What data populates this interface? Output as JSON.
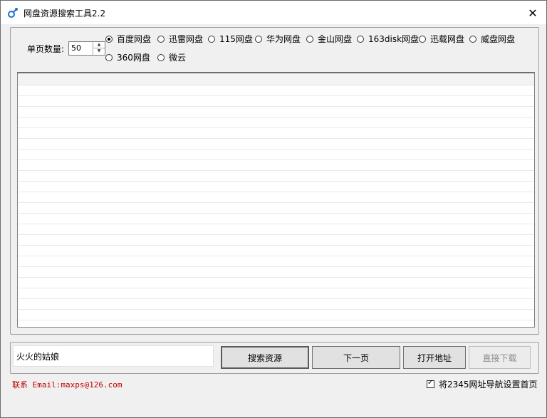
{
  "window": {
    "title": "网盘资源搜索工具2.2",
    "close_glyph": "✕"
  },
  "settings": {
    "count_label": "单页数量:",
    "count_value": "50"
  },
  "providers": [
    {
      "label": "百度网盘",
      "selected": true
    },
    {
      "label": "迅雷网盘",
      "selected": false
    },
    {
      "label": "115网盘",
      "selected": false
    },
    {
      "label": "华为网盘",
      "selected": false
    },
    {
      "label": "金山网盘",
      "selected": false
    },
    {
      "label": "163disk网盘",
      "selected": false
    },
    {
      "label": "迅载网盘",
      "selected": false
    },
    {
      "label": "威盘网盘",
      "selected": false
    },
    {
      "label": "360网盘",
      "selected": false
    },
    {
      "label": "微云",
      "selected": false
    }
  ],
  "search": {
    "value": "火火的姑娘"
  },
  "buttons": {
    "search": "搜索资源",
    "next": "下一页",
    "open": "打开地址",
    "download": "直接下载"
  },
  "footer": {
    "contact": "联系 Email:maxps@126.com",
    "homepage_checkbox_label": "将2345网址导航设置首页",
    "homepage_checked": true
  },
  "colors": {
    "contact_text": "#c00000",
    "window_bg": "#f0f0f0"
  },
  "icons": {
    "app": "cloud-link-icon",
    "close": "close-icon",
    "spin_up": "spin-up-icon",
    "spin_down": "spin-down-icon"
  }
}
